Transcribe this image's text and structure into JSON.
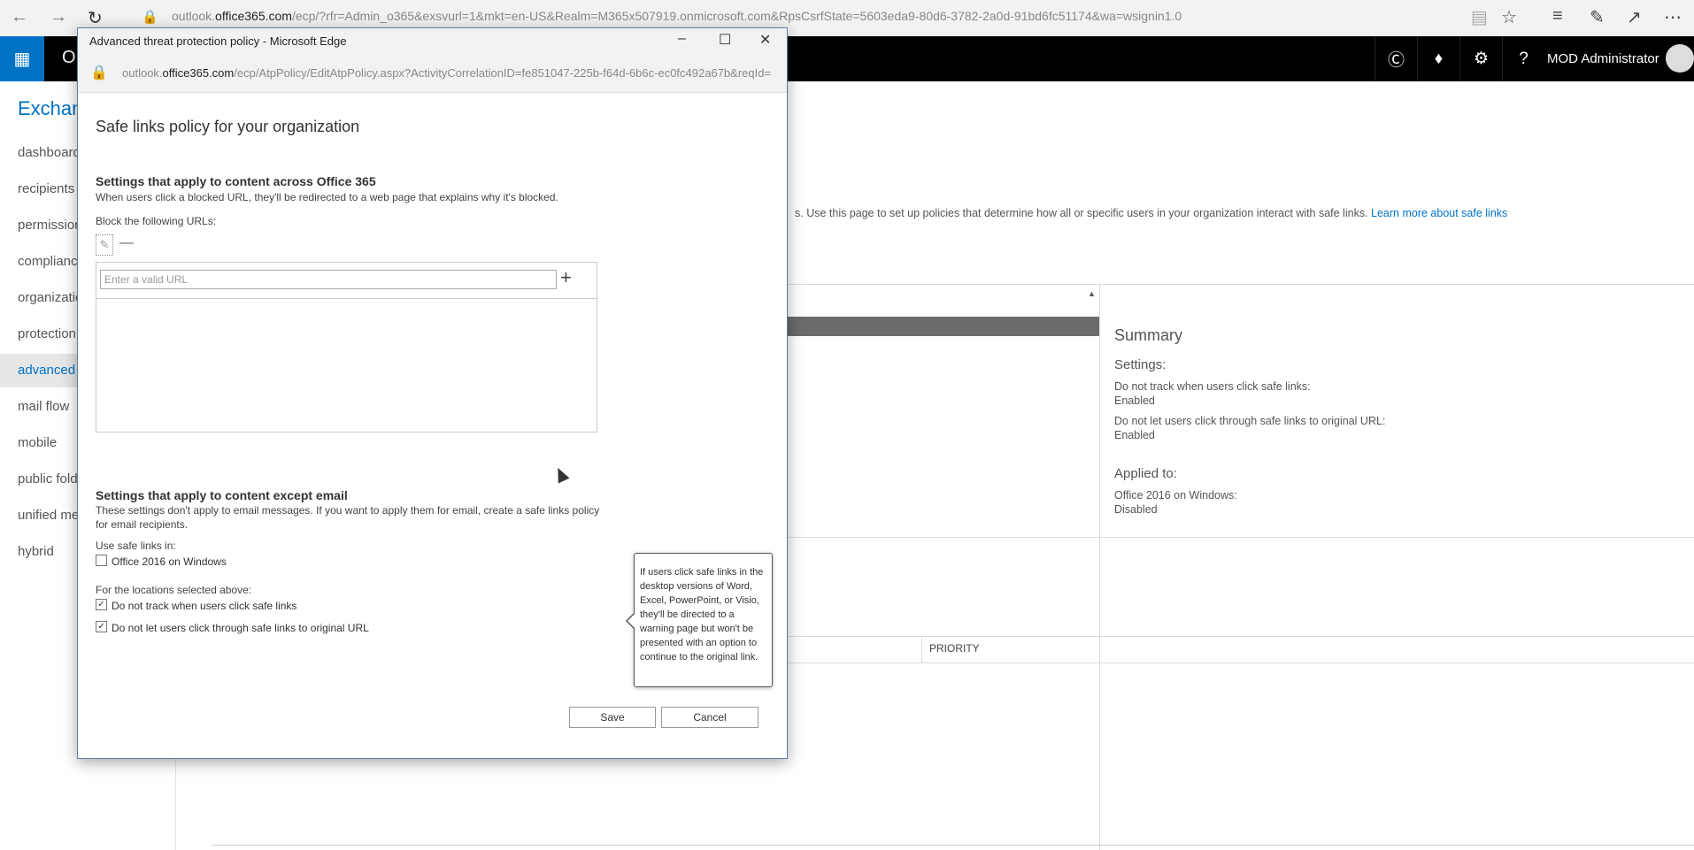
{
  "browser": {
    "url_prefix": "outlook.",
    "url_domain": "office365.com",
    "url_rest": "/ecp/?rfr=Admin_o365&exsvurl=1&mkt=en-US&Realm=M365x507919.onmicrosoft.com&RpsCsrfState=5603eda9-80d6-3782-2a0d-91bd6fc51174&wa=wsignin1.0"
  },
  "suite_header": {
    "app_initial": "O",
    "user_name": "MOD Administrator"
  },
  "left_nav": {
    "app_title": "Exchan",
    "items": [
      {
        "label": "dashboard"
      },
      {
        "label": "recipients"
      },
      {
        "label": "permission"
      },
      {
        "label": "compliance"
      },
      {
        "label": "organizatio"
      },
      {
        "label": "protection"
      },
      {
        "label": "advanced"
      },
      {
        "label": "mail flow"
      },
      {
        "label": "mobile"
      },
      {
        "label": "public fold"
      },
      {
        "label": "unified me"
      },
      {
        "label": "hybrid"
      }
    ],
    "selected_index": 6
  },
  "background_page": {
    "description": "s. Use this page to set up policies that determine how all or specific users in your organization interact with safe links.",
    "learn_more": "Learn more about safe links",
    "summary": {
      "title": "Summary",
      "settings_label": "Settings:",
      "track_label": "Do not track when users click safe links:",
      "track_value": "Enabled",
      "clickthrough_label": "Do not let users click through safe links to original URL:",
      "clickthrough_value": "Enabled",
      "applied_label": "Applied to:",
      "office_label": "Office 2016 on Windows:",
      "office_value": "Disabled"
    },
    "priority_header": "PRIORITY"
  },
  "popup": {
    "window_title": "Advanced threat protection policy - Microsoft Edge",
    "url_prefix": "outlook.",
    "url_domain": "office365.com",
    "url_rest": "/ecp/AtpPolicy/EditAtpPolicy.aspx?ActivityCorrelationID=fe851047-225b-f64d-6b6c-ec0fc492a67b&reqId=",
    "dialog_title": "Safe links policy for your organization",
    "section1": {
      "heading": "Settings that apply to content across Office 365",
      "description": "When users click a blocked URL, they'll be redirected to a web page that explains why it's blocked.",
      "block_label": "Block the following URLs:",
      "url_input_value": "",
      "url_input_placeholder": "Enter a valid URL"
    },
    "section2": {
      "heading": "Settings that apply to content except email",
      "description_line1": "These settings don't apply to email messages. If you want to apply them for email, create a safe links policy",
      "description_line2": "for email recipients.",
      "use_in_label": "Use safe links in:",
      "office_checkbox_label": "Office 2016 on Windows",
      "office_checked": false,
      "locations_label": "For the locations selected above:",
      "track_checkbox_label": "Do not track when users click safe links",
      "track_checked": true,
      "clickthrough_checkbox_label": "Do not let users click through safe links to original URL",
      "clickthrough_checked": true
    },
    "tooltip": "If users click safe links in the desktop versions of Word, Excel, PowerPoint, or Visio, they'll be directed to a warning page but won't be presented with an option to continue to the original link.",
    "save_label": "Save",
    "cancel_label": "Cancel"
  }
}
